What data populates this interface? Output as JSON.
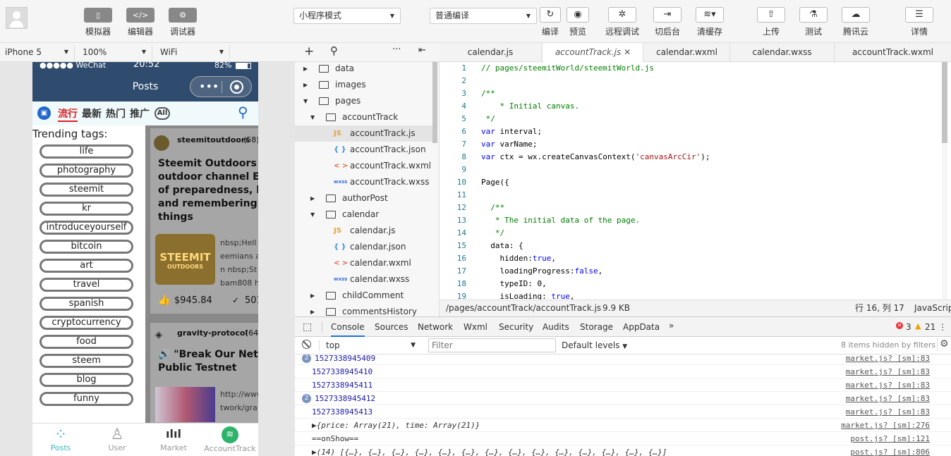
{
  "toolbar": {
    "simulator": "模拟器",
    "editor": "编辑器",
    "debugger": "调试器",
    "mode": "小程序模式",
    "compile_mode": "普通编译",
    "compile": "编译",
    "preview": "预览",
    "remote_debug": "远程调试",
    "background": "切后台",
    "clear_cache": "清缓存",
    "upload": "上传",
    "test": "测试",
    "tencent_cloud": "腾讯云",
    "details": "详情"
  },
  "device": {
    "model": "iPhone 5",
    "zoom": "100%",
    "network": "WiFi"
  },
  "phone": {
    "carrier": "●●●●● WeChat",
    "time": "20:52",
    "battery": "82%",
    "title": "Posts",
    "tabs": [
      "流行",
      "最新",
      "热门",
      "推广"
    ],
    "all": "All",
    "trending_title": "Trending tags:",
    "tags": [
      "life",
      "photography",
      "steemit",
      "kr",
      "introduceyourself",
      "bitcoin",
      "art",
      "travel",
      "spanish",
      "cryptocurrency",
      "food",
      "steem",
      "blog",
      "funny"
    ],
    "post1": {
      "author": "steemitoutdoors",
      "rep": "(58)",
      "title_lines": [
        "Steemit Outdoors St",
        "outdoor channel EPI",
        "of preparedness, kee",
        "and remembering a",
        "things"
      ],
      "excerpt_lines": [
        "nbsp;Hell",
        "eemians a",
        "n nbsp;St",
        "bam808 h"
      ],
      "logo_text": "STEEMIT",
      "logo_sub": "OUTDOORS",
      "payout": "$945.84",
      "votes": "501"
    },
    "post2": {
      "author": "gravity-protocol",
      "rep": "(64)",
      "title_lines": [
        "🔊 \"Break Our Net\" G",
        "Public Testnet"
      ],
      "excerpt_lines": [
        "http://www",
        "twork/gra"
      ]
    },
    "tabbar": [
      "Posts",
      "User",
      "Market",
      "AccountTrack"
    ]
  },
  "tree": {
    "items": [
      {
        "label": "data",
        "type": "folder",
        "depth": 0,
        "open": false
      },
      {
        "label": "images",
        "type": "folder",
        "depth": 0,
        "open": false
      },
      {
        "label": "pages",
        "type": "folder",
        "depth": 0,
        "open": true
      },
      {
        "label": "accountTrack",
        "type": "folder",
        "depth": 1,
        "open": true
      },
      {
        "label": "accountTrack.js",
        "type": "js",
        "depth": 2
      },
      {
        "label": "accountTrack.json",
        "type": "json",
        "depth": 2
      },
      {
        "label": "accountTrack.wxml",
        "type": "wxml",
        "depth": 2
      },
      {
        "label": "accountTrack.wxss",
        "type": "wxss",
        "depth": 2
      },
      {
        "label": "authorPost",
        "type": "folder",
        "depth": 1,
        "open": false
      },
      {
        "label": "calendar",
        "type": "folder",
        "depth": 1,
        "open": true
      },
      {
        "label": "calendar.js",
        "type": "js",
        "depth": 2
      },
      {
        "label": "calendar.json",
        "type": "json",
        "depth": 2
      },
      {
        "label": "calendar.wxml",
        "type": "wxml",
        "depth": 2
      },
      {
        "label": "calendar.wxss",
        "type": "wxss",
        "depth": 2
      },
      {
        "label": "childComment",
        "type": "folder",
        "depth": 1,
        "open": false
      },
      {
        "label": "commentsHistory",
        "type": "folder",
        "depth": 1,
        "open": false
      }
    ],
    "icons": {
      "js": "JS",
      "json": "{ }",
      "wxml": "< >",
      "wxss": "wxss"
    }
  },
  "editor": {
    "tabs": [
      "calendar.js",
      "accountTrack.js",
      "calendar.wxml",
      "calendar.wxss",
      "accountTrack.wxml"
    ],
    "lines": [
      "// pages/steemitWorld/steemitWorld.js",
      "",
      "/**",
      "    * Initial canvas.",
      " */",
      "var interval;",
      "var varName;",
      "var ctx = wx.createCanvasContext('canvasArcCir');",
      "",
      "Page({",
      "",
      "  /**",
      "   * The initial data of the page.",
      "   */",
      "  data: {",
      "    hidden:true,",
      "    loadingProgress:false,",
      "    typeID: 0,",
      "    isLoading: true,"
    ],
    "line_numbers": [
      "1",
      "2",
      "3",
      "4",
      "5",
      "6",
      "7",
      "8",
      "9",
      "10",
      "11",
      "12",
      "13",
      "14",
      "15",
      "16",
      "17",
      "18",
      "19"
    ],
    "status_path": "/pages/accountTrack/accountTrack.js",
    "status_size": "9.9 KB",
    "status_pos": "行 16, 列 17",
    "status_lang": "JavaScript"
  },
  "devtools": {
    "tabs": [
      "Console",
      "Sources",
      "Network",
      "Wxml",
      "Security",
      "Audits",
      "Storage",
      "AppData"
    ],
    "errors": "3",
    "warnings": "21",
    "context": "top",
    "filter_placeholder": "Filter",
    "levels": "Default levels",
    "hidden": "8 items hidden by filters",
    "rows": [
      {
        "badge": "2",
        "text": "1527338945409",
        "src": "market.js? [sm]:83",
        "num": true
      },
      {
        "badge": "",
        "text": "1527338945410",
        "src": "market.js? [sm]:83",
        "num": true
      },
      {
        "badge": "",
        "text": "1527338945411",
        "src": "market.js? [sm]:83",
        "num": true
      },
      {
        "badge": "2",
        "text": "1527338945412",
        "src": "market.js? [sm]:83",
        "num": true
      },
      {
        "badge": "",
        "text": "1527338945413",
        "src": "market.js? [sm]:83",
        "num": true
      },
      {
        "badge": "",
        "text": "▶{price: Array(21), time: Array(21)}",
        "src": "market.js? [sm]:276",
        "num": false
      },
      {
        "badge": "",
        "text": "==onShow==",
        "src": "post.js? [sm]:121",
        "num": false
      },
      {
        "badge": "",
        "text": "▶(14) [{…}, {…}, {…}, {…}, {…}, {…}, {…}, {…}, {…}, {…}, {…}, {…}, {…}, {…}]",
        "src": "post.js? [sm]:806",
        "num": false
      }
    ]
  }
}
